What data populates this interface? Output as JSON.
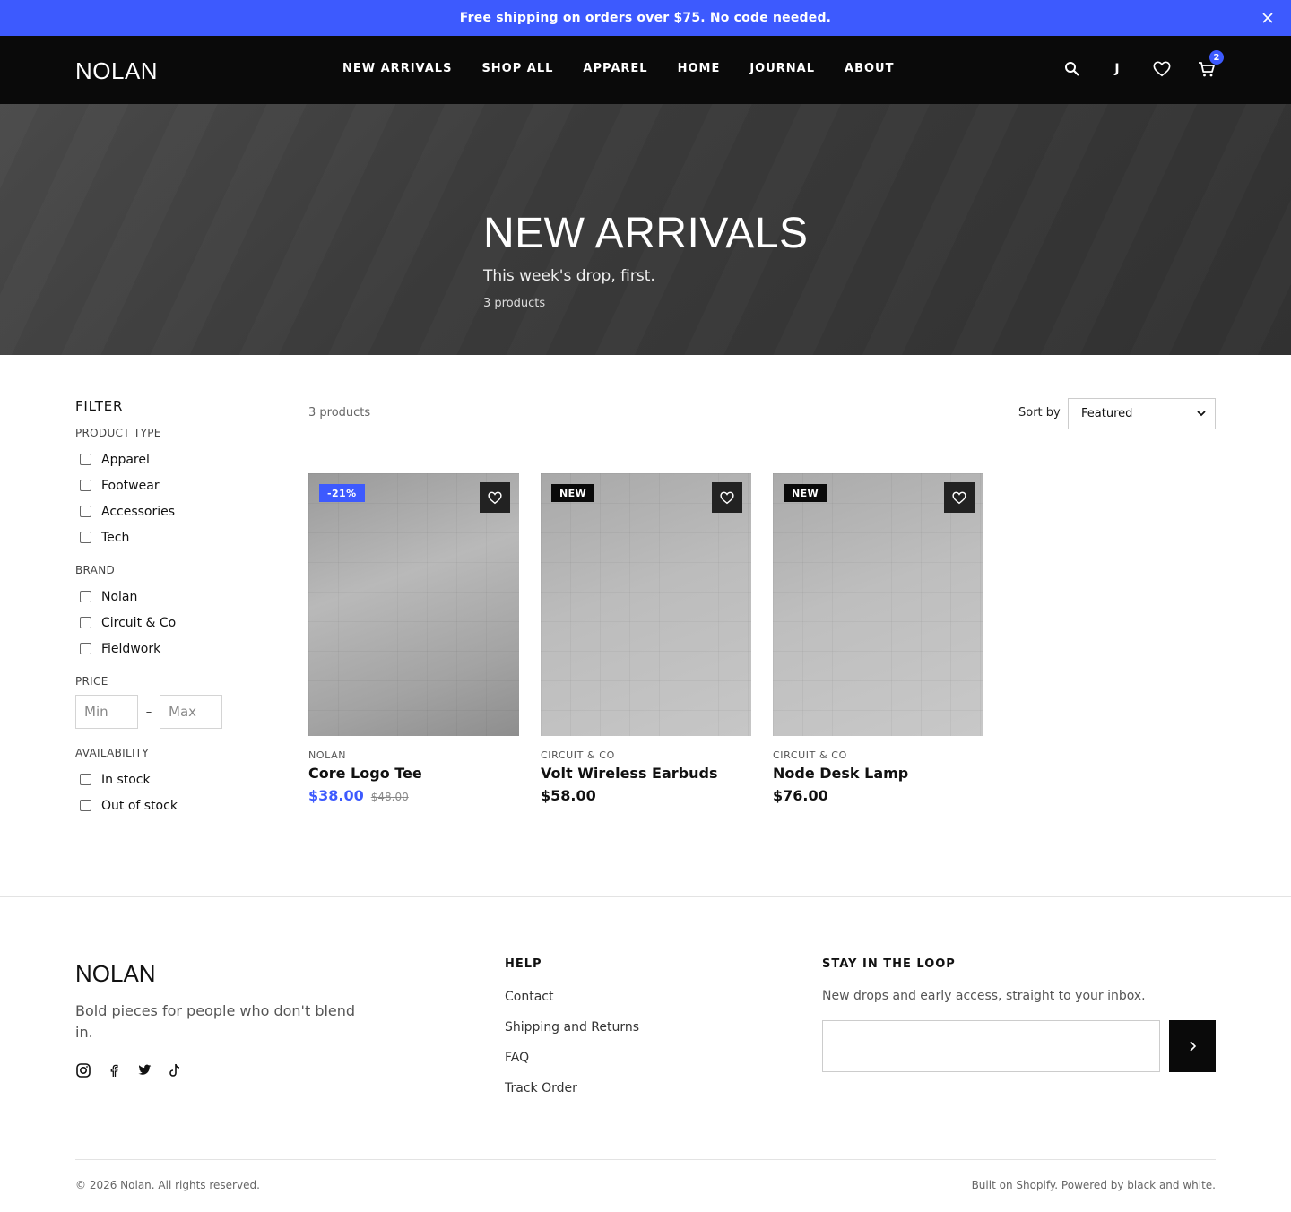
{
  "announcement": {
    "text": "Free shipping on orders over $75. No code needed.",
    "close_icon": "close-icon"
  },
  "header": {
    "logo": "NOLAN",
    "nav": [
      "NEW ARRIVALS",
      "SHOP ALL",
      "APPAREL",
      "HOME",
      "JOURNAL",
      "ABOUT"
    ],
    "account_initial": "J",
    "cart_count": "2",
    "icons": [
      "search-icon",
      "account-icon",
      "heart-icon",
      "cart-icon"
    ]
  },
  "hero": {
    "title": "NEW ARRIVALS",
    "subtitle": "This week's drop, first.",
    "count": "3 products"
  },
  "filters": {
    "title": "FILTER",
    "product_type": {
      "title": "PRODUCT TYPE",
      "options": [
        "Apparel",
        "Footwear",
        "Accessories",
        "Tech"
      ]
    },
    "brand": {
      "title": "BRAND",
      "options": [
        "Nolan",
        "Circuit & Co",
        "Fieldwork"
      ]
    },
    "price": {
      "title": "PRICE",
      "min_placeholder": "Min",
      "max_placeholder": "Max",
      "separator": "–"
    },
    "availability": {
      "title": "AVAILABILITY",
      "options": [
        "In stock",
        "Out of stock"
      ]
    }
  },
  "toolbar": {
    "count": "3 products",
    "sort_label": "Sort by",
    "sort_value": "Featured"
  },
  "products": [
    {
      "badge": "-21%",
      "badge_color": "#3d5afe",
      "brand": "NOLAN",
      "name": "Core Logo Tee",
      "price": "$38.00",
      "compare_price": "$48.00",
      "price_color": "#3d5afe"
    },
    {
      "badge": "NEW",
      "badge_color": "#0a0a0a",
      "brand": "CIRCUIT & CO",
      "name": "Volt Wireless Earbuds",
      "price": "$58.00",
      "compare_price": "",
      "price_color": "#111111"
    },
    {
      "badge": "NEW",
      "badge_color": "#0a0a0a",
      "brand": "CIRCUIT & CO",
      "name": "Node Desk Lamp",
      "price": "$76.00",
      "compare_price": "",
      "price_color": "#111111"
    }
  ],
  "footer": {
    "logo": "NOLAN",
    "tagline": "Bold pieces for people who don't blend in.",
    "socials": [
      "instagram-icon",
      "facebook-icon",
      "twitter-icon",
      "tiktok-icon"
    ],
    "help": {
      "title": "HELP",
      "links": [
        "Contact",
        "Shipping and Returns",
        "FAQ",
        "Track Order"
      ]
    },
    "newsletter": {
      "title": "STAY IN THE LOOP",
      "text": "New drops and early access, straight to your inbox."
    },
    "copyright": "© 2026 Nolan. All rights reserved.",
    "powered": "Built on Shopify. Powered by black and white."
  },
  "colors": {
    "accent": "#3d5afe",
    "header_bg": "#0a0a0a"
  }
}
